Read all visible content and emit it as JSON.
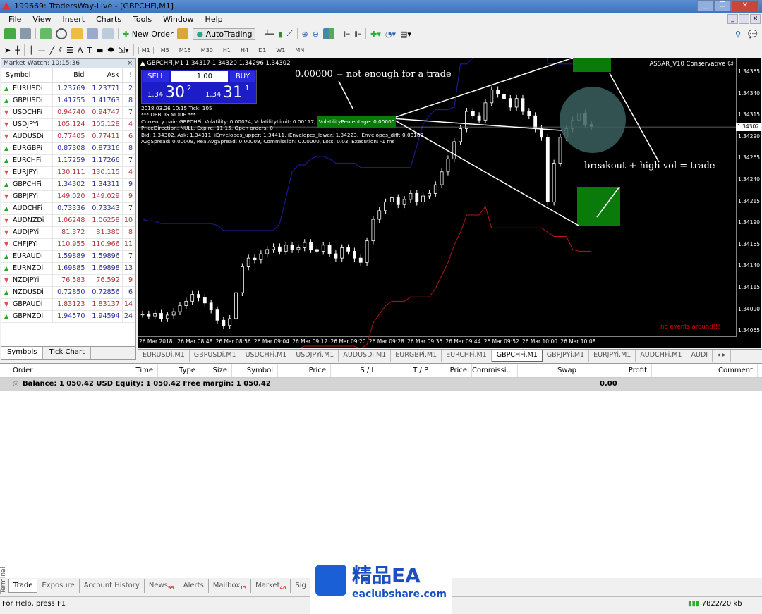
{
  "window": {
    "title": "199669: TradersWay-Live - [GBPCHFi,M1]"
  },
  "menu": [
    "File",
    "View",
    "Insert",
    "Charts",
    "Tools",
    "Window",
    "Help"
  ],
  "toolbar": {
    "new_order": "New Order",
    "autotrading": "AutoTrading",
    "timeframes": [
      "M1",
      "M5",
      "M15",
      "M30",
      "H1",
      "H4",
      "D1",
      "W1",
      "MN"
    ]
  },
  "market_watch": {
    "title": "Market Watch: 10:15:36",
    "columns": [
      "Symbol",
      "Bid",
      "Ask",
      "!"
    ],
    "rows": [
      {
        "symbol": "EURUSDi",
        "bid": "1.23769",
        "ask": "1.23771",
        "spread": "2",
        "dir": "up"
      },
      {
        "symbol": "GBPUSDi",
        "bid": "1.41755",
        "ask": "1.41763",
        "spread": "8",
        "dir": "up"
      },
      {
        "symbol": "USDCHFi",
        "bid": "0.94740",
        "ask": "0.94747",
        "spread": "7",
        "dir": "down"
      },
      {
        "symbol": "USDJPYi",
        "bid": "105.124",
        "ask": "105.128",
        "spread": "4",
        "dir": "down"
      },
      {
        "symbol": "AUDUSDi",
        "bid": "0.77405",
        "ask": "0.77411",
        "spread": "6",
        "dir": "down"
      },
      {
        "symbol": "EURGBPi",
        "bid": "0.87308",
        "ask": "0.87316",
        "spread": "8",
        "dir": "up"
      },
      {
        "symbol": "EURCHFi",
        "bid": "1.17259",
        "ask": "1.17266",
        "spread": "7",
        "dir": "up"
      },
      {
        "symbol": "EURJPYi",
        "bid": "130.111",
        "ask": "130.115",
        "spread": "4",
        "dir": "down"
      },
      {
        "symbol": "GBPCHFi",
        "bid": "1.34302",
        "ask": "1.34311",
        "spread": "9",
        "dir": "up"
      },
      {
        "symbol": "GBPJPYi",
        "bid": "149.020",
        "ask": "149.029",
        "spread": "9",
        "dir": "down"
      },
      {
        "symbol": "AUDCHFi",
        "bid": "0.73336",
        "ask": "0.73343",
        "spread": "7",
        "dir": "up"
      },
      {
        "symbol": "AUDNZDi",
        "bid": "1.06248",
        "ask": "1.06258",
        "spread": "10",
        "dir": "down"
      },
      {
        "symbol": "AUDJPYi",
        "bid": "81.372",
        "ask": "81.380",
        "spread": "8",
        "dir": "down"
      },
      {
        "symbol": "CHFJPYi",
        "bid": "110.955",
        "ask": "110.966",
        "spread": "11",
        "dir": "down"
      },
      {
        "symbol": "EURAUDi",
        "bid": "1.59889",
        "ask": "1.59896",
        "spread": "7",
        "dir": "up"
      },
      {
        "symbol": "EURNZDi",
        "bid": "1.69885",
        "ask": "1.69898",
        "spread": "13",
        "dir": "up"
      },
      {
        "symbol": "NZDJPYi",
        "bid": "76.583",
        "ask": "76.592",
        "spread": "9",
        "dir": "down"
      },
      {
        "symbol": "NZDUSDi",
        "bid": "0.72850",
        "ask": "0.72856",
        "spread": "6",
        "dir": "up"
      },
      {
        "symbol": "GBPAUDi",
        "bid": "1.83123",
        "ask": "1.83137",
        "spread": "14",
        "dir": "down"
      },
      {
        "symbol": "GBPNZDi",
        "bid": "1.94570",
        "ask": "1.94594",
        "spread": "24",
        "dir": "up"
      }
    ],
    "tabs": [
      "Symbols",
      "Tick Chart"
    ]
  },
  "chart": {
    "header": "GBPCHFi,M1  1.34317 1.34320 1.34296 1.34302",
    "ea_name": "ASSAR_V10 Conservative",
    "sell_label": "SELL",
    "buy_label": "BUY",
    "lots": "1.00",
    "sell_price": {
      "prefix": "1.34",
      "big": "30",
      "sup": "2"
    },
    "buy_price": {
      "prefix": "1.34",
      "big": "31",
      "sup": "1"
    },
    "debug": [
      "2018.03.26 10:15 Tick: 105",
      "*** DEBUG MODE ***",
      "Currency pair: GBPCHFi, Volatility: 0.00024, VolatilityLimit: 0.00117,",
      "PriceDirection: NULL, Expire: 11:15, Open orders: 0",
      "Bid: 1.34302, Ask: 1.34311, iEnvelopes_upper: 1.34411, iEnvelopes_lower: 1.34223, iEnvelopes_diff: 0.00188",
      "AvgSpread: 0.00009, RealAvgSpread: 0.00009, Commission: 0.00000, Lots: 0.03, Execution: -1 ms"
    ],
    "vol_pct": "VolatilityPercentage: 0.00000",
    "annotation_1": "0.00000 = not enough for a trade",
    "annotation_2": "breakout + high vol = trade",
    "no_events": "no events around!!!",
    "current_price": "1.34302",
    "price_ticks": [
      "1.34365",
      "1.34340",
      "1.34315",
      "1.34290",
      "1.34265",
      "1.34240",
      "1.34215",
      "1.34190",
      "1.34165",
      "1.34140",
      "1.34115",
      "1.34090",
      "1.34065"
    ],
    "time_ticks": [
      "26 Mar 2018",
      "26 Mar 08:48",
      "26 Mar 08:56",
      "26 Mar 09:04",
      "26 Mar 09:12",
      "26 Mar 09:20",
      "26 Mar 09:28",
      "26 Mar 09:36",
      "26 Mar 09:44",
      "26 Mar 09:52",
      "26 Mar 10:00",
      "26 Mar 10:08"
    ],
    "closes": [
      1.34085,
      1.34083,
      1.34086,
      1.3408,
      1.34084,
      1.34088,
      1.34095,
      1.341,
      1.34108,
      1.34104,
      1.34098,
      1.3409,
      1.34078,
      1.34072,
      1.3408,
      1.3411,
      1.3414,
      1.3415,
      1.34148,
      1.34155,
      1.3416,
      1.34163,
      1.34158,
      1.34165,
      1.3416,
      1.34162,
      1.34168,
      1.3416,
      1.34158,
      1.34165,
      1.34155,
      1.3415,
      1.34162,
      1.34158,
      1.3415,
      1.34145,
      1.3417,
      1.34195,
      1.34205,
      1.34215,
      1.3422,
      1.34212,
      1.34218,
      1.34225,
      1.34215,
      1.34222,
      1.34225,
      1.34235,
      1.3425,
      1.34265,
      1.34285,
      1.343,
      1.3432,
      1.34315,
      1.3431,
      1.3433,
      1.34345,
      1.3434,
      1.34335,
      1.34325,
      1.34335,
      1.3432,
      1.34315,
      1.343,
      1.3429,
      1.34215,
      1.3426,
      1.3429,
      1.343,
      1.3431,
      1.34318,
      1.34305,
      1.34302
    ],
    "colors": {
      "bull": "#ffffff",
      "bear": "#ffffff",
      "upper_envelope": "#1a1a8c",
      "lower_envelope": "#b01818",
      "annotation_box": "#0a7a0a"
    }
  },
  "chart_tabs": [
    "EURUSDi,M1",
    "GBPUSDi,M1",
    "USDCHFi,M1",
    "USDJPYi,M1",
    "AUDUSDi,M1",
    "EURGBPi,M1",
    "EURCHFi,M1",
    "GBPCHFi,M1",
    "GBPJPYi,M1",
    "EURJPYi,M1",
    "AUDCHFi,M1",
    "AUDI"
  ],
  "terminal": {
    "columns": [
      "Order",
      "Time",
      "Type",
      "Size",
      "Symbol",
      "Price",
      "S / L",
      "T / P",
      "Price",
      "Commissi...",
      "Swap",
      "Profit",
      "Comment"
    ],
    "balance": "Balance: 1 050.42 USD  Equity: 1 050.42  Free margin: 1 050.42",
    "profit": "0.00",
    "side_label": "Terminal",
    "tabs": [
      {
        "label": "Trade"
      },
      {
        "label": "Exposure"
      },
      {
        "label": "Account History"
      },
      {
        "label": "News",
        "badge": "99"
      },
      {
        "label": "Alerts"
      },
      {
        "label": "Mailbox",
        "badge": "15"
      },
      {
        "label": "Market",
        "badge": "46"
      },
      {
        "label": "Sig"
      }
    ]
  },
  "status": {
    "help": "For Help, press F1",
    "traffic": "7822/20 kb"
  },
  "watermark": {
    "title": "精品EA",
    "site": "eaclubshare.com"
  }
}
